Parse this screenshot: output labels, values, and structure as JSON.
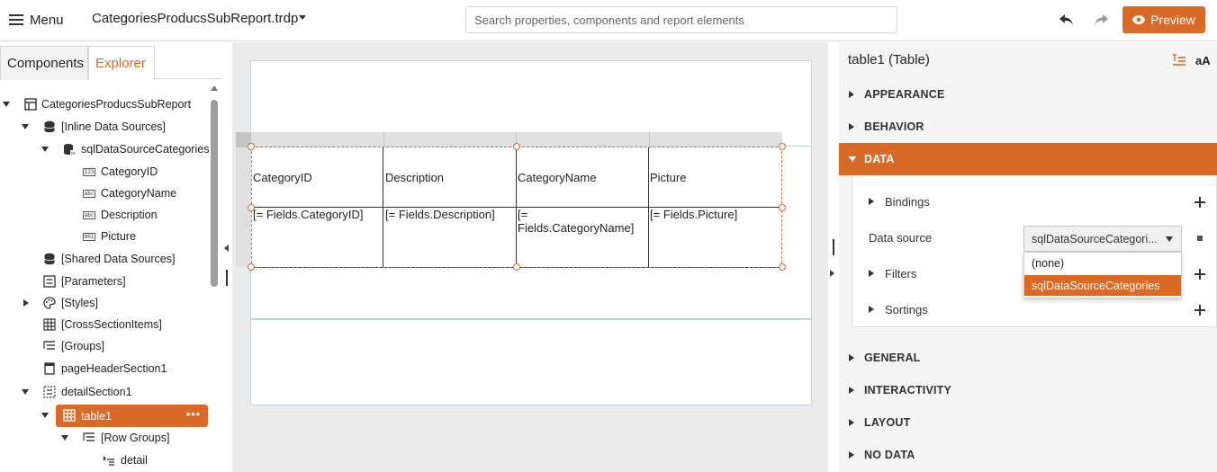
{
  "toolbar": {
    "menu_label": "Menu",
    "file_name": "CategoriesProducsSubReport.trdp",
    "search_placeholder": "Search properties, components and report elements",
    "preview_label": "Preview",
    "accent_color": "#d96a27"
  },
  "left_panel": {
    "tabs": [
      {
        "label": "Components",
        "active": false
      },
      {
        "label": "Explorer",
        "active": true
      }
    ],
    "tree": [
      {
        "label": "CategoriesProducsSubReport",
        "icon": "report-icon",
        "expanded": true
      },
      {
        "label": "[Inline Data Sources]",
        "icon": "database-icon",
        "expanded": true
      },
      {
        "label": "sqlDataSourceCategories",
        "icon": "sql-database-icon",
        "expanded": true
      },
      {
        "label": "CategoryID",
        "icon": "numeric-field-icon",
        "tag": "123"
      },
      {
        "label": "CategoryName",
        "icon": "text-field-icon",
        "tag": "abc"
      },
      {
        "label": "Description",
        "icon": "text-field-icon",
        "tag": "abc"
      },
      {
        "label": "Picture",
        "icon": "binary-field-icon",
        "tag": "001"
      },
      {
        "label": "[Shared Data Sources]",
        "icon": "database-icon"
      },
      {
        "label": "[Parameters]",
        "icon": "parameters-icon"
      },
      {
        "label": "[Styles]",
        "icon": "palette-icon",
        "expanded": false
      },
      {
        "label": "[CrossSectionItems]",
        "icon": "grid-icon"
      },
      {
        "label": "[Groups]",
        "icon": "groups-icon"
      },
      {
        "label": "pageHeaderSection1",
        "icon": "page-icon"
      },
      {
        "label": "detailSection1",
        "icon": "section-icon",
        "expanded": true
      },
      {
        "label": "table1",
        "icon": "table-icon",
        "expanded": true,
        "selected": true
      },
      {
        "label": "[Row Groups]",
        "icon": "groups-icon",
        "expanded": true
      },
      {
        "label": "detail",
        "icon": "row-group-icon"
      }
    ]
  },
  "designer": {
    "table": {
      "headers": [
        "CategoryID",
        "Description",
        "CategoryName",
        "Picture"
      ],
      "cells": [
        "[= Fields.CategoryID]",
        "[= Fields.Description]",
        "[= Fields.CategoryName]",
        "[= Fields.Picture]"
      ]
    }
  },
  "properties": {
    "title": "table1 (Table)",
    "font_toggle_label": "aA",
    "categories": [
      {
        "label": "APPEARANCE",
        "open": false
      },
      {
        "label": "BEHAVIOR",
        "open": false
      },
      {
        "label": "DATA",
        "open": true
      },
      {
        "label": "GENERAL",
        "open": false
      },
      {
        "label": "INTERACTIVITY",
        "open": false
      },
      {
        "label": "LAYOUT",
        "open": false
      },
      {
        "label": "NO DATA",
        "open": false
      }
    ],
    "data": {
      "bindings_label": "Bindings",
      "data_source_label": "Data source",
      "data_source_value": "sqlDataSourceCategori...",
      "filters_label": "Filters",
      "sortings_label": "Sortings",
      "options": [
        {
          "label": "(none)",
          "selected": false
        },
        {
          "label": "sqlDataSourceCategories",
          "selected": true
        }
      ]
    }
  }
}
